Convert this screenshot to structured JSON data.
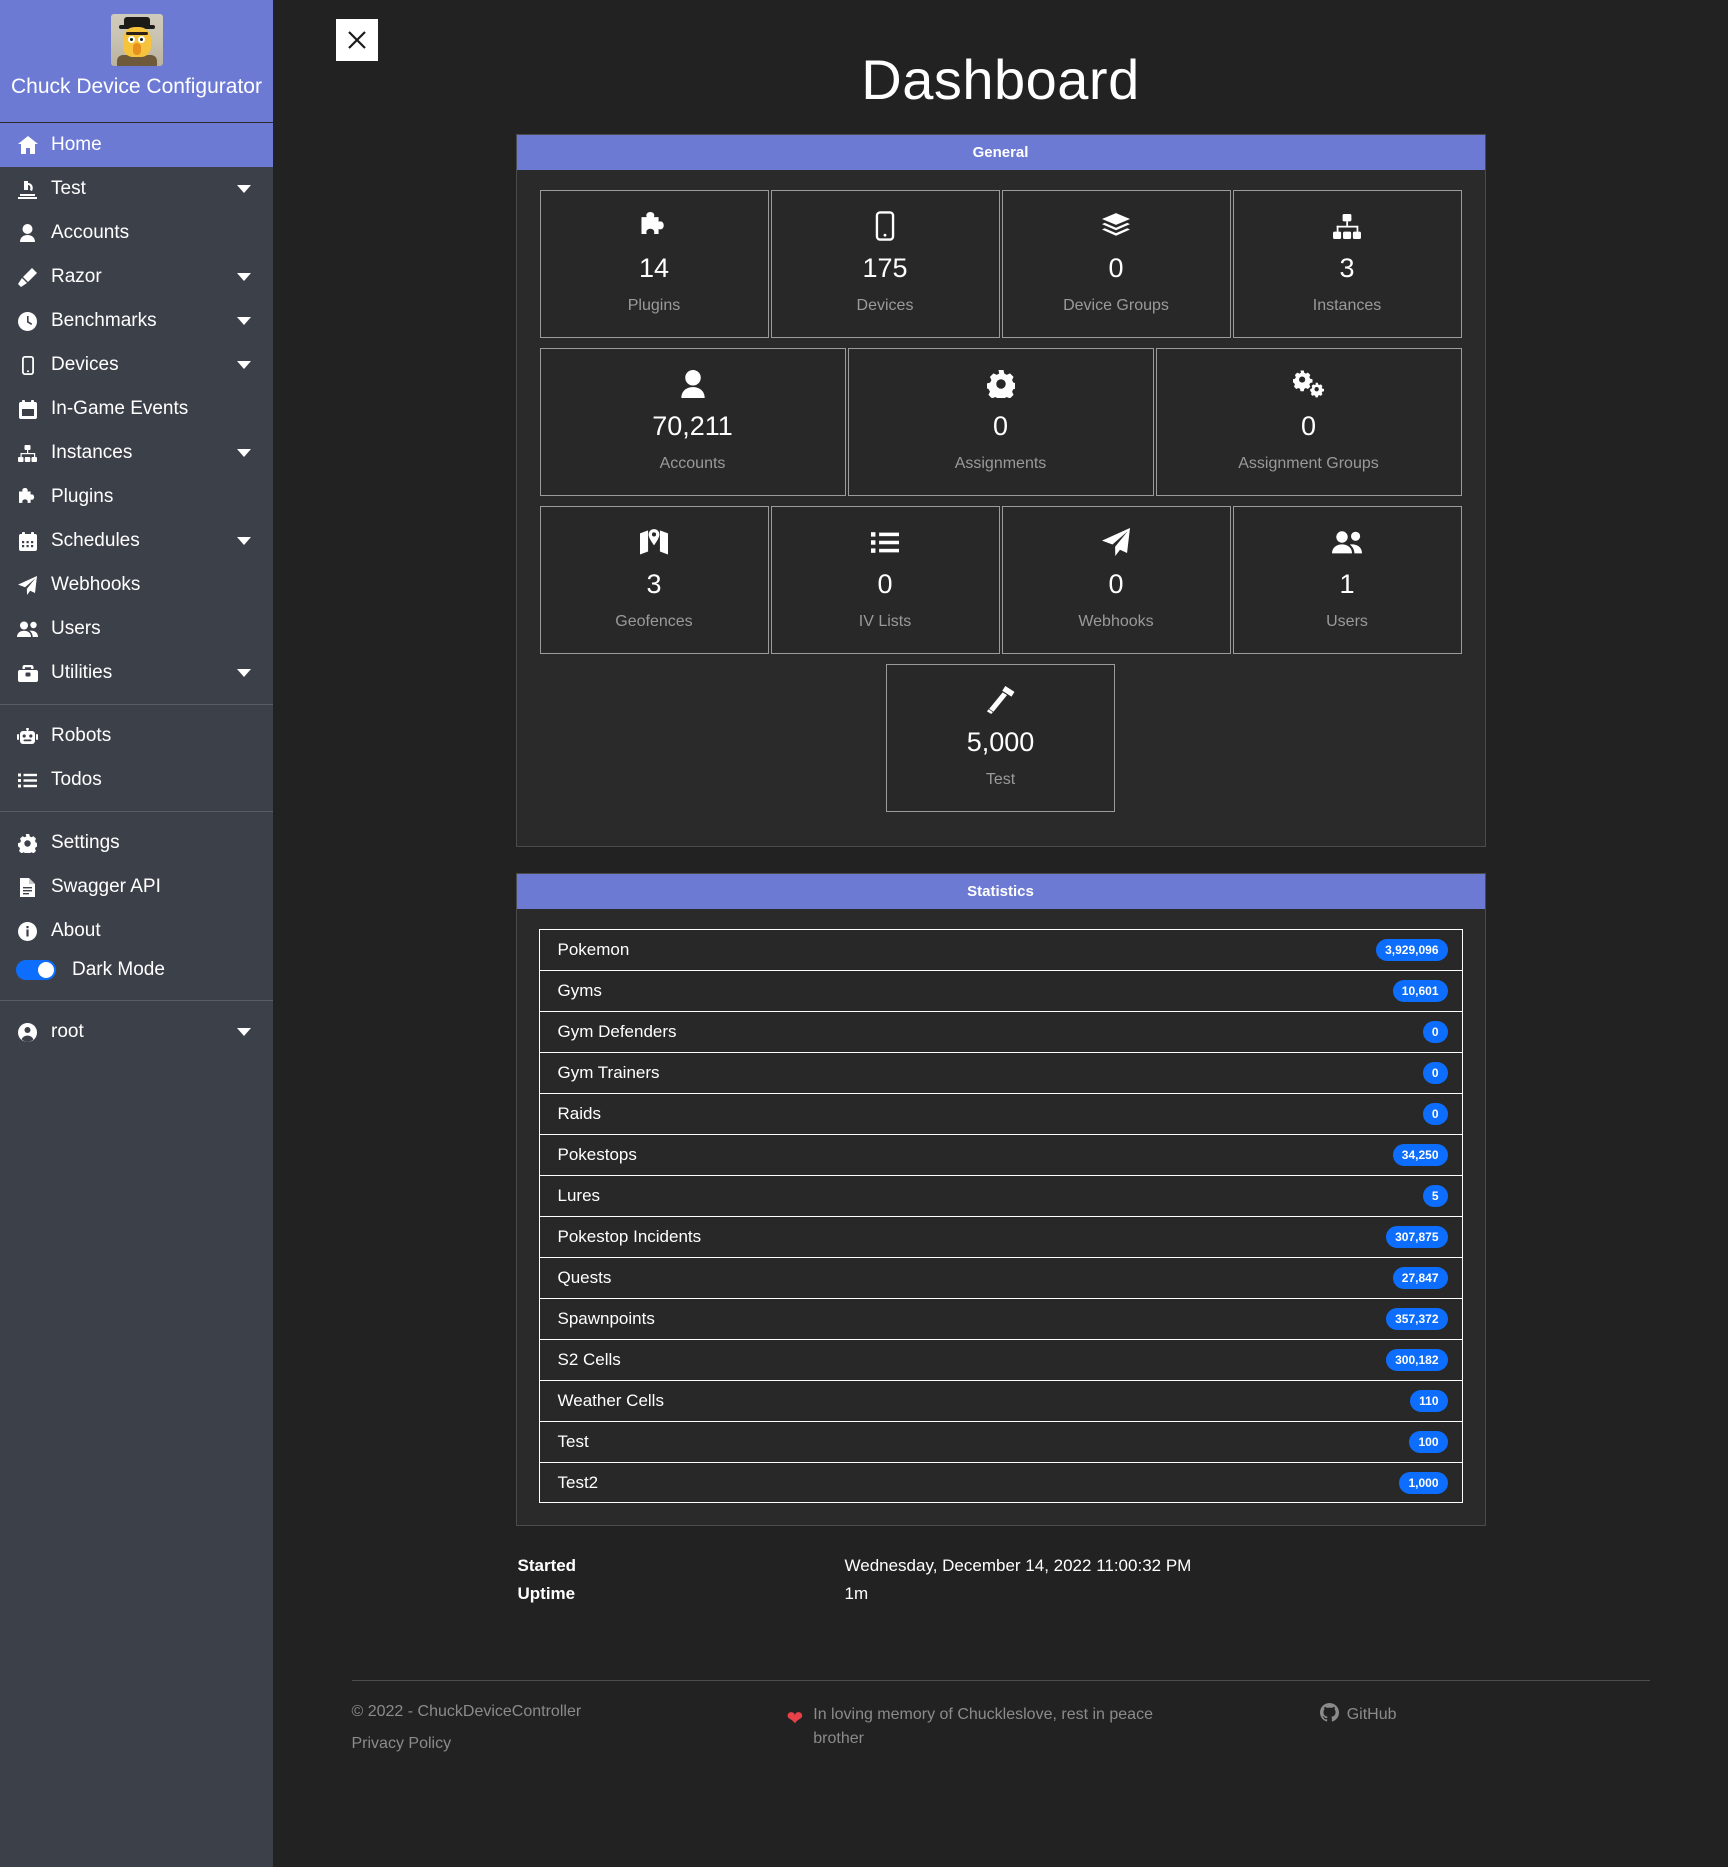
{
  "sidebar": {
    "brand_title": "Chuck Device Configurator",
    "avatar_icon": "bert-avatar",
    "items": [
      {
        "label": "Home",
        "icon": "home-icon",
        "active": true,
        "caret": false
      },
      {
        "label": "Test",
        "icon": "microscope-icon",
        "active": false,
        "caret": true
      },
      {
        "label": "Accounts",
        "icon": "user-icon",
        "active": false,
        "caret": false
      },
      {
        "label": "Razor",
        "icon": "pen-icon",
        "active": false,
        "caret": true
      },
      {
        "label": "Benchmarks",
        "icon": "clock-icon",
        "active": false,
        "caret": true
      },
      {
        "label": "Devices",
        "icon": "mobile-icon",
        "active": false,
        "caret": true
      },
      {
        "label": "In-Game Events",
        "icon": "calendar-icon",
        "active": false,
        "caret": false
      },
      {
        "label": "Instances",
        "icon": "sitemap-icon",
        "active": false,
        "caret": true
      },
      {
        "label": "Plugins",
        "icon": "puzzle-icon",
        "active": false,
        "caret": false
      },
      {
        "label": "Schedules",
        "icon": "calendar-alt-icon",
        "active": false,
        "caret": true
      },
      {
        "label": "Webhooks",
        "icon": "paper-plane-icon",
        "active": false,
        "caret": false
      },
      {
        "label": "Users",
        "icon": "users-icon",
        "active": false,
        "caret": false
      },
      {
        "label": "Utilities",
        "icon": "toolbox-icon",
        "active": false,
        "caret": true
      }
    ],
    "group2": [
      {
        "label": "Robots",
        "icon": "robot-icon"
      },
      {
        "label": "Todos",
        "icon": "list-icon"
      }
    ],
    "group3": [
      {
        "label": "Settings",
        "icon": "gear-icon"
      },
      {
        "label": "Swagger API",
        "icon": "file-icon"
      },
      {
        "label": "About",
        "icon": "info-circle-icon"
      }
    ],
    "dark_mode": {
      "label": "Dark Mode",
      "enabled": true
    },
    "account": {
      "label": "root",
      "icon": "user-circle-icon",
      "caret": true
    }
  },
  "header": {
    "title": "Dashboard",
    "close_icon": "close-icon"
  },
  "general": {
    "panel_title": "General",
    "row1": [
      {
        "icon": "puzzle-icon",
        "value": "14",
        "label": "Plugins"
      },
      {
        "icon": "mobile-icon",
        "value": "175",
        "label": "Devices"
      },
      {
        "icon": "layers-icon",
        "value": "0",
        "label": "Device Groups"
      },
      {
        "icon": "sitemap-icon",
        "value": "3",
        "label": "Instances"
      }
    ],
    "row2": [
      {
        "icon": "user-icon",
        "value": "70,211",
        "label": "Accounts"
      },
      {
        "icon": "gear-icon",
        "value": "0",
        "label": "Assignments"
      },
      {
        "icon": "gears-icon",
        "value": "0",
        "label": "Assignment Groups"
      }
    ],
    "row3": [
      {
        "icon": "map-icon",
        "value": "3",
        "label": "Geofences"
      },
      {
        "icon": "list-icon",
        "value": "0",
        "label": "IV Lists"
      },
      {
        "icon": "paper-plane-icon",
        "value": "0",
        "label": "Webhooks"
      },
      {
        "icon": "users-icon",
        "value": "1",
        "label": "Users"
      }
    ],
    "row4": [
      {
        "icon": "hammer-icon",
        "value": "5,000",
        "label": "Test"
      }
    ]
  },
  "statistics": {
    "panel_title": "Statistics",
    "rows": [
      {
        "name": "Pokemon",
        "value": "3,929,096"
      },
      {
        "name": "Gyms",
        "value": "10,601"
      },
      {
        "name": "Gym Defenders",
        "value": "0"
      },
      {
        "name": "Gym Trainers",
        "value": "0"
      },
      {
        "name": "Raids",
        "value": "0"
      },
      {
        "name": "Pokestops",
        "value": "34,250"
      },
      {
        "name": "Lures",
        "value": "5"
      },
      {
        "name": "Pokestop Incidents",
        "value": "307,875"
      },
      {
        "name": "Quests",
        "value": "27,847"
      },
      {
        "name": "Spawnpoints",
        "value": "357,372"
      },
      {
        "name": "S2 Cells",
        "value": "300,182"
      },
      {
        "name": "Weather Cells",
        "value": "110"
      },
      {
        "name": "Test",
        "value": "100"
      },
      {
        "name": "Test2",
        "value": "1,000"
      }
    ]
  },
  "meta": {
    "started_label": "Started",
    "started_value": "Wednesday, December 14, 2022 11:00:32 PM",
    "uptime_label": "Uptime",
    "uptime_value": "1m"
  },
  "footer": {
    "copyright": "© 2022 - ChuckDeviceController",
    "privacy": "Privacy Policy",
    "memorial": "In loving memory of Chuckleslove, rest in peace brother",
    "heart_icon": "heart-icon",
    "github_label": "GitHub",
    "github_icon": "github-icon"
  },
  "colors": {
    "accent": "#6c7ad4",
    "badge": "#0d6efd",
    "sidebar_bg": "#3c4049",
    "page_bg": "#222222",
    "heart": "#e8414a"
  }
}
